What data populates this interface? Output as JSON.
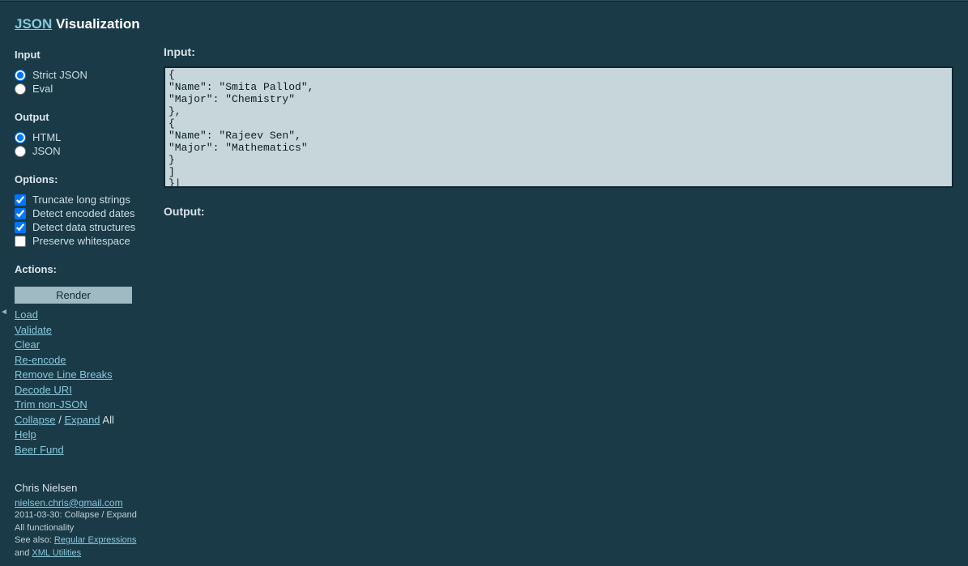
{
  "title_link": "JSON",
  "title_rest": " Visualization",
  "sidebar": {
    "input_head": "Input",
    "input_opts": [
      {
        "label": "Strict JSON",
        "checked": true
      },
      {
        "label": "Eval",
        "checked": false
      }
    ],
    "output_head": "Output",
    "output_opts": [
      {
        "label": "HTML",
        "checked": true
      },
      {
        "label": "JSON",
        "checked": false
      }
    ],
    "options_head": "Options:",
    "options_opts": [
      {
        "label": "Truncate long strings",
        "checked": true
      },
      {
        "label": "Detect encoded dates",
        "checked": true
      },
      {
        "label": "Detect data structures",
        "checked": true
      },
      {
        "label": "Preserve whitespace",
        "checked": false
      }
    ],
    "actions_head": "Actions:",
    "render_btn": "Render",
    "links": {
      "load": "Load",
      "validate": "Validate",
      "clear": "Clear",
      "reencode": "Re-encode",
      "removelb": "Remove Line Breaks",
      "decodeuri": "Decode URI",
      "trimnon": "Trim non-JSON",
      "collapse": "Collapse",
      "expand": "Expand",
      "all_suffix": " All",
      "sep": " / ",
      "help": "Help",
      "beer": "Beer Fund"
    }
  },
  "footer": {
    "author": "Chris Nielsen",
    "email": "nielsen.chris@gmail.com",
    "changelog": "2011-03-30: Collapse / Expand All functionality",
    "seealso_prefix": "See also: ",
    "seealso_regex": "Regular Expressions",
    "seealso_and": " and ",
    "seealso_xml": "XML Utilities"
  },
  "main": {
    "input_head": "Input:",
    "output_head": "Output:",
    "textarea_value": "{\n\"Name\": \"Smita Pallod\",\n\"Major\": \"Chemistry\"\n},\n{\n\"Name\": \"Rajeev Sen\",\n\"Major\": \"Mathematics\"\n}\n]\n}|"
  },
  "collapse_glyph": "◄"
}
